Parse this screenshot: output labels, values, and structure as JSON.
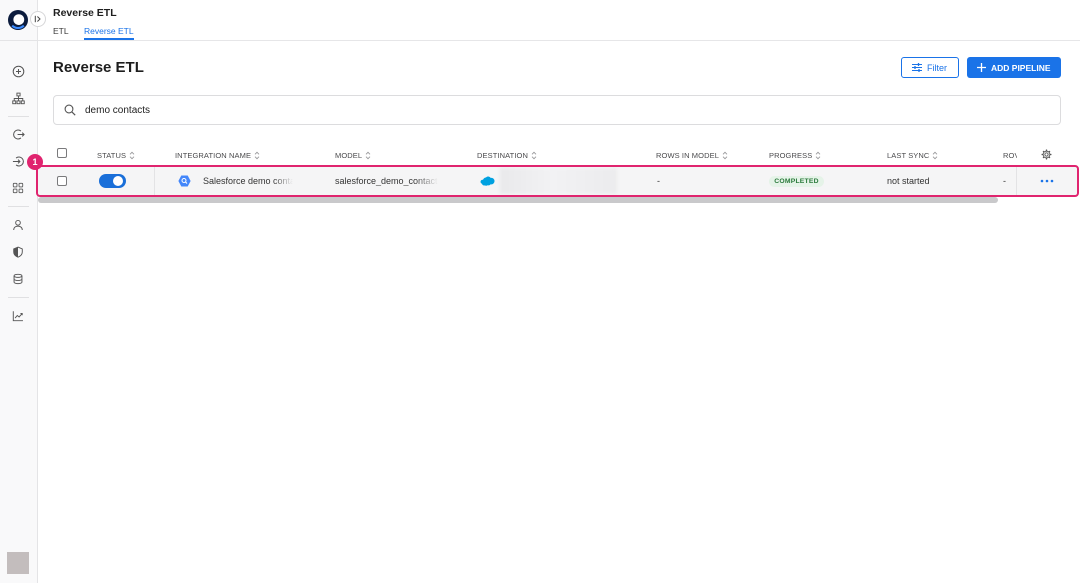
{
  "header": {
    "title": "Reverse ETL",
    "tabs": [
      {
        "label": "ETL",
        "active": false
      },
      {
        "label": "Reverse ETL",
        "active": true
      }
    ]
  },
  "sidebar": {
    "logo_icon": "logo-icon",
    "expand_icon": "sidebar-expand-icon",
    "items": [
      {
        "icon": "plus-circle-icon"
      },
      {
        "icon": "hierarchy-icon"
      },
      {
        "icon": "export-icon"
      },
      {
        "icon": "import-icon"
      },
      {
        "icon": "apps-grid-icon"
      },
      {
        "icon": "user-icon"
      },
      {
        "icon": "shield-icon"
      },
      {
        "icon": "database-icon"
      },
      {
        "icon": "line-chart-icon"
      }
    ],
    "avatar": "avatar"
  },
  "page": {
    "title": "Reverse ETL",
    "filter_button": {
      "label": "Filter",
      "icon": "sliders-icon"
    },
    "add_button": {
      "label": "ADD PIPELINE",
      "icon": "plus-icon"
    },
    "search": {
      "value": "demo contacts",
      "icon": "search-icon"
    }
  },
  "table": {
    "columns": [
      "STATUS",
      "INTEGRATION NAME",
      "MODEL",
      "DESTINATION",
      "ROWS IN MODEL",
      "PROGRESS",
      "LAST SYNC",
      "ROV"
    ],
    "settings_icon": "gear-icon",
    "rows": [
      {
        "selected": false,
        "status_enabled": true,
        "integration_icon": "bigquery-icon",
        "integration_name": "Salesforce demo conta",
        "model": "salesforce_demo_contact",
        "destination_icon": "salesforce-cloud-icon",
        "rows_in_model": "-",
        "progress": "COMPLETED",
        "last_sync": "not started",
        "last_column": "-",
        "actions_icon": "more-dots-icon"
      }
    ]
  },
  "annotation": {
    "step": "1"
  },
  "colors": {
    "accent": "#1a73e8",
    "highlight": "#e0246f",
    "success_text": "#2a7a3b",
    "success_bg": "#e5f3e8",
    "salesforce": "#00a1e0",
    "logo": "#0c1c3d"
  }
}
